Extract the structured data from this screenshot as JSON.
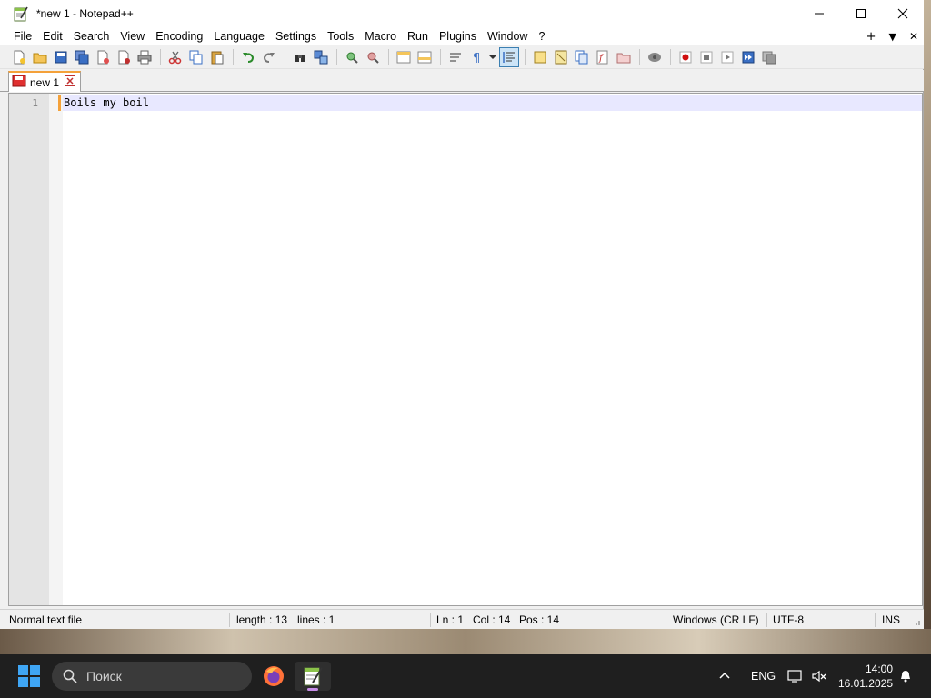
{
  "window": {
    "title": "*new 1 - Notepad++"
  },
  "menu": {
    "items": [
      "File",
      "Edit",
      "Search",
      "View",
      "Encoding",
      "Language",
      "Settings",
      "Tools",
      "Macro",
      "Run",
      "Plugins",
      "Window",
      "?"
    ],
    "right": {
      "add": "+",
      "dropdown": "▼",
      "close": "✕"
    }
  },
  "tabs": [
    {
      "label": "new 1",
      "modified": true
    }
  ],
  "editor": {
    "lines": [
      {
        "number": "1",
        "text": "Boils my boil"
      }
    ],
    "colors": {
      "current_line": "#e8e8ff",
      "gutter": "#e4e4e4",
      "accent": "#f4a13a"
    }
  },
  "status": {
    "file_type": "Normal text file",
    "length": "length : 13",
    "lines": "lines : 1",
    "ln": "Ln : 1",
    "col": "Col : 14",
    "pos": "Pos : 14",
    "eol": "Windows (CR LF)",
    "encoding": "UTF-8",
    "mode": "INS"
  },
  "taskbar": {
    "search_placeholder": "Поиск",
    "language": "ENG",
    "time": "14:00",
    "date": "16.01.2025"
  }
}
